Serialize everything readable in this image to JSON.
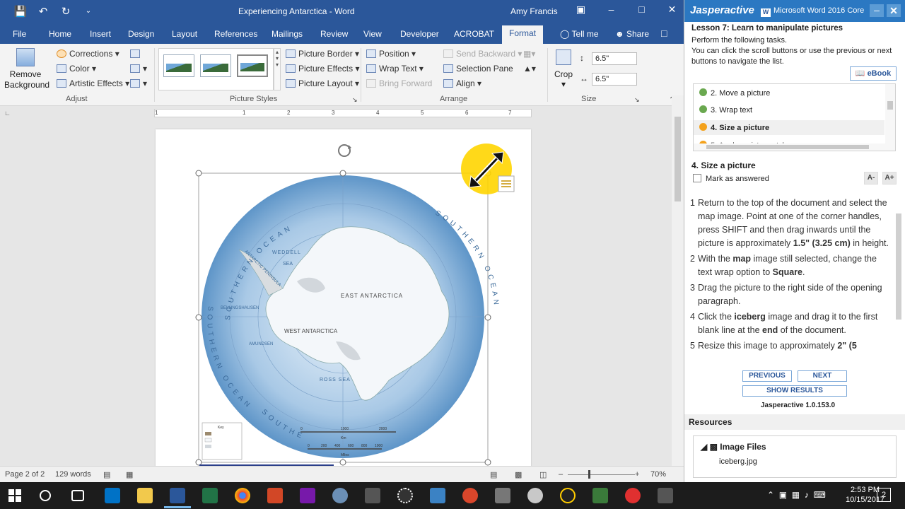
{
  "word": {
    "doc_title": "Experiencing Antarctica  -  Word",
    "user": "Amy Francis",
    "tabs": [
      "File",
      "Home",
      "Insert",
      "Design",
      "Layout",
      "References",
      "Mailings",
      "Review",
      "View",
      "Developer",
      "ACROBAT"
    ],
    "active_tab": "Format",
    "tell_me": "Tell me",
    "share": "Share",
    "ribbon": {
      "remove_background": "Remove Background",
      "corrections": "Corrections",
      "color": "Color",
      "artistic_effects": "Artistic Effects",
      "adjust_label": "Adjust",
      "picture_border": "Picture Border",
      "picture_effects": "Picture Effects",
      "picture_layout": "Picture Layout",
      "picture_styles_label": "Picture Styles",
      "position": "Position",
      "wrap_text": "Wrap Text",
      "bring_forward": "Bring Forward",
      "send_backward": "Send Backward",
      "selection_pane": "Selection Pane",
      "align": "Align",
      "arrange_label": "Arrange",
      "crop": "Crop",
      "height": "6.5\"",
      "width": "6.5\"",
      "size_label": "Size"
    },
    "ruler_marks": [
      "1",
      "1",
      "2",
      "3",
      "4",
      "5",
      "6",
      "7"
    ],
    "map": {
      "ocean_top": "SOUTHERN OCEAN",
      "ocean_right": "SOUTHERN OCEAN",
      "ocean_left": "SOUTHERN OCEAN",
      "ocean_bottom": "SOUTHERN OCEAN",
      "east": "EAST ANTARCTICA",
      "west": "WEST ANTARCTICA",
      "weddell": "WEDDELL",
      "sea": "SEA",
      "ross": "ROSS SEA",
      "bellingshausen": "BELLINGSHAUSEN",
      "amundsen": "AMUNDSEN",
      "peninsula": "ANTARCTIC PENINSULA",
      "key_title": "Key",
      "scale_km": "Km",
      "scale_miles": "Miles",
      "scale_ticks": [
        "0",
        "1000",
        "2000"
      ],
      "scale_ticks_miles": [
        "0",
        "200",
        "400",
        "600",
        "800",
        "1000"
      ]
    },
    "status": {
      "page": "Page 2 of 2",
      "words": "129 words",
      "zoom": "70%"
    }
  },
  "panel": {
    "brand": "Jasperactive",
    "product": "Microsoft Word 2016 Core",
    "lesson": "Lesson 7: Learn to manipulate pictures",
    "intro": "Perform the following tasks.\nYou can click the scroll buttons or use the previous or next buttons to navigate the list.",
    "ebook": "eBook",
    "tasks": [
      {
        "label": "2. Move a picture",
        "status": "done"
      },
      {
        "label": "3. Wrap text",
        "status": "done"
      },
      {
        "label": "4. Size a picture",
        "status": "current"
      },
      {
        "label": "5. Apply a picture style",
        "status": "pending"
      }
    ],
    "task_heading": "4. Size a picture",
    "mark_answered": "Mark as answered",
    "font_down": "A-",
    "font_up": "A+",
    "steps": [
      {
        "n": "1",
        "html": "Return to the top of the document and select the map image. Point at one of the corner handles, press SHIFT and then drag inwards until the picture is approximately <b>1.5\" (3.25 cm)</b> in height."
      },
      {
        "n": "2",
        "html": "With the <b>map</b> image still selected, change the text wrap option to <b>Square</b>."
      },
      {
        "n": "3",
        "html": "Drag the picture to the right side of the opening paragraph."
      },
      {
        "n": "4",
        "html": "Click the <b>iceberg</b> image and drag it to the first blank line at the <b>end</b> of the document."
      },
      {
        "n": "5",
        "html": "Resize this image to approximately <b>2\" (5</b>"
      }
    ],
    "previous": "PREVIOUS",
    "next": "NEXT",
    "show_results": "SHOW RESULTS",
    "version": "Jasperactive 1.0.153.0",
    "resources": "Resources",
    "image_files": "Image Files",
    "iceberg_file": "iceberg.jpg"
  },
  "taskbar": {
    "time": "2:53 PM",
    "date": "10/15/2017",
    "notifications": "2"
  }
}
